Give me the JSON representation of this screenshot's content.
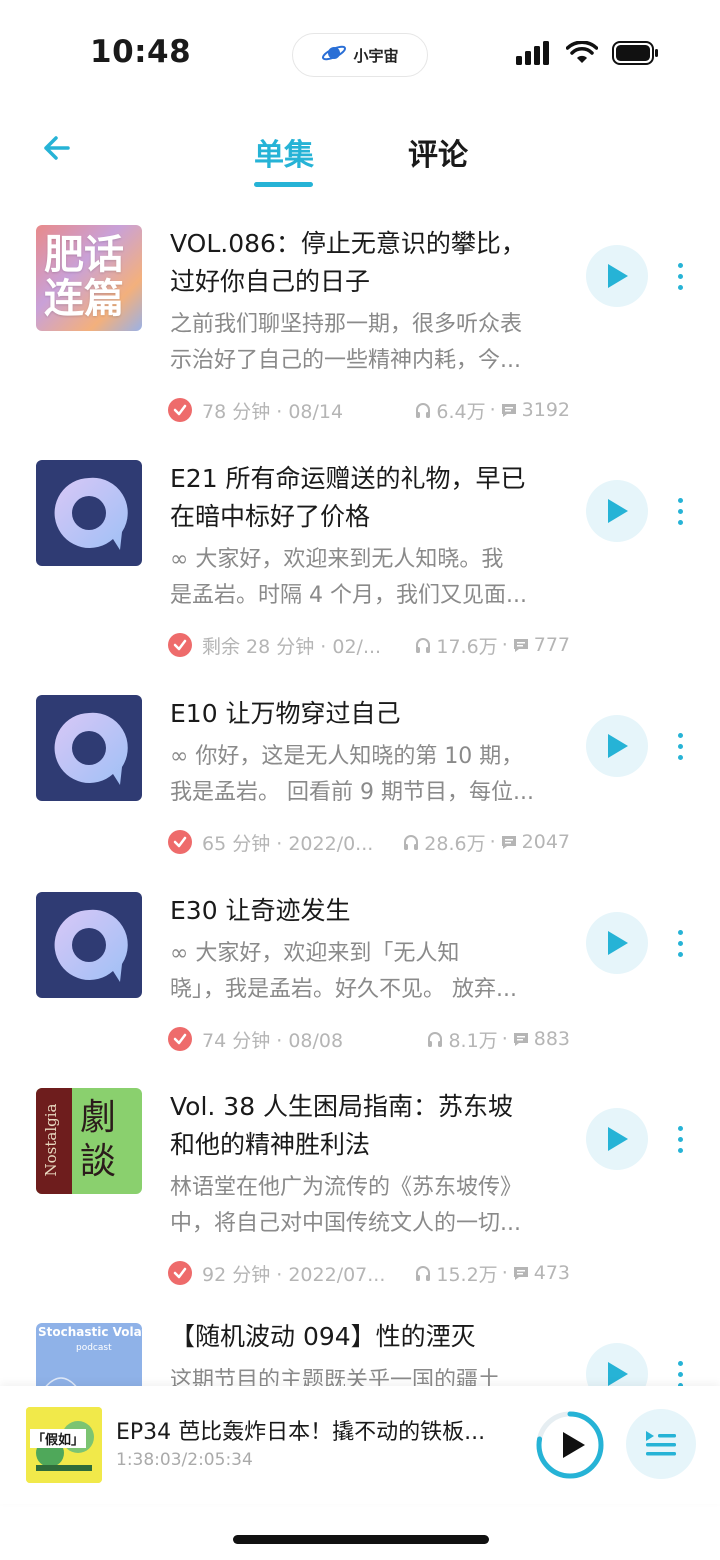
{
  "status_bar": {
    "time": "10:48",
    "app_name": "小宇宙"
  },
  "header": {
    "tabs": [
      {
        "label": "单集",
        "active": true
      },
      {
        "label": "评论",
        "active": false
      }
    ],
    "accent_color": "#26b3d6"
  },
  "episodes": [
    {
      "cover": {
        "text_lines": [
          "肥话",
          "连篇"
        ]
      },
      "title_lines": [
        "VOL.086：停止无意识的攀比，",
        "过好你自己的日子"
      ],
      "desc_lines": [
        "之前我们聊坚持那一期，很多听众表",
        "示治好了自己的一些精神内耗，今..."
      ],
      "meta": "78 分钟 · 08/14",
      "listens": "6.4万",
      "comments": "3192"
    },
    {
      "title_lines": [
        "E21 所有命运赠送的礼物，早已",
        "在暗中标好了价格"
      ],
      "desc_lines": [
        "∞ 大家好，欢迎来到无人知晓。我",
        "是孟岩。时隔 4 个月，我们又见面..."
      ],
      "meta": "剩余 28 分钟 · 02/...",
      "listens": "17.6万",
      "comments": "777"
    },
    {
      "title_lines": [
        "E10 让万物穿过自己"
      ],
      "desc_lines": [
        "∞ 你好，这是无人知晓的第 10 期，",
        "我是孟岩。 回看前 9 期节目，每位..."
      ],
      "meta": "65 分钟 · 2022/0...",
      "listens": "28.6万",
      "comments": "2047"
    },
    {
      "title_lines": [
        "E30 让奇迹发生"
      ],
      "desc_lines": [
        "∞ 大家好，欢迎来到「无人知",
        "晓」，我是孟岩。好久不见。 放弃..."
      ],
      "meta": "74 分钟 · 08/08",
      "listens": "8.1万",
      "comments": "883"
    },
    {
      "cover": {
        "side_text": "Nostalgia",
        "main_text": [
          "劇",
          "談"
        ]
      },
      "title_lines": [
        "Vol. 38 人生困局指南：苏东坡",
        "和他的精神胜利法"
      ],
      "desc_lines": [
        "林语堂在他广为流传的《苏东坡传》",
        "中，将自己对中国传统文人的一切..."
      ],
      "meta": "92 分钟 · 2022/07...",
      "listens": "15.2万",
      "comments": "473"
    },
    {
      "cover": {
        "title": "Stochastic Volatility",
        "subtitle": "podcast"
      },
      "title_lines": [
        "【随机波动 094】性的湮灭"
      ],
      "desc_lines": [
        "这期节目的主题既关乎一国的疆土"
      ]
    }
  ],
  "player": {
    "title": "EP34 芭比轰炸日本！撬不动的铁板...",
    "time": "1:38:03/2:05:34",
    "progress": 0.78,
    "cover_text": "「假如」"
  }
}
